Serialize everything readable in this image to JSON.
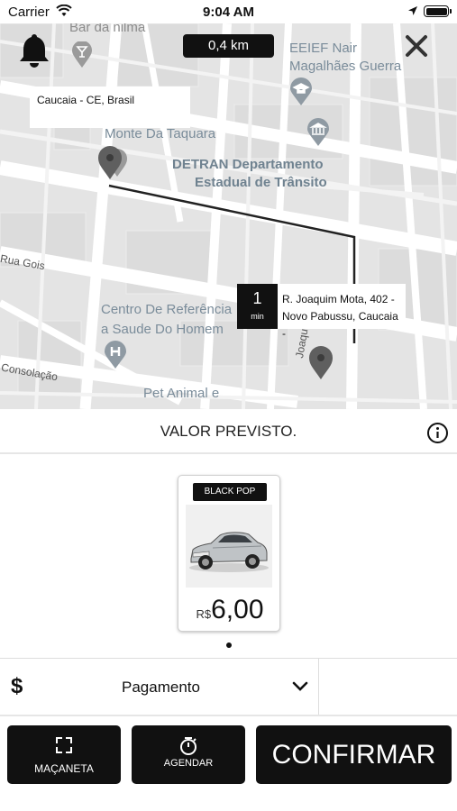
{
  "status_bar": {
    "carrier": "Carrier",
    "time": "9:04 AM"
  },
  "map": {
    "distance": "0,4 km",
    "origin_label": "Caucaia - CE, Brasil",
    "destination_time": "1",
    "destination_time_unit": "min",
    "destination_address_line1": "R. Joaquim Mota, 402 -",
    "destination_address_line2": "Novo Pabussu, Caucaia -",
    "places": {
      "bar": "Bar da nilma",
      "school_1": "EEIEF Nair",
      "school_2": "Magalhães Guerra",
      "monte": "Monte Da Taquara",
      "detran_1": "DETRAN Departamento",
      "detran_2": "Estadual de Trânsito",
      "street_gois": "Rua Gois",
      "centro_1": "Centro De Referência",
      "centro_2": "a Saude Do Homem",
      "street_consolacao": "Consolação",
      "pet": "Pet Animal e",
      "street_joaquim": "Joaquim Mo"
    }
  },
  "estimate": {
    "title": "VALOR PREVISTO."
  },
  "vehicle": {
    "category": "BLACK POP",
    "currency": "R$",
    "price": "6,00"
  },
  "payment": {
    "label": "Pagamento",
    "symbol": "$"
  },
  "actions": {
    "macaneta": "MAÇANETA",
    "agendar": "AGENDAR",
    "confirm": "CONFIRMAR"
  },
  "icons": {
    "bell": "bell-icon",
    "close": "close-icon",
    "info": "info-icon",
    "chevron": "chevron-down-icon",
    "expand": "expand-icon",
    "timer": "stopwatch-icon"
  }
}
